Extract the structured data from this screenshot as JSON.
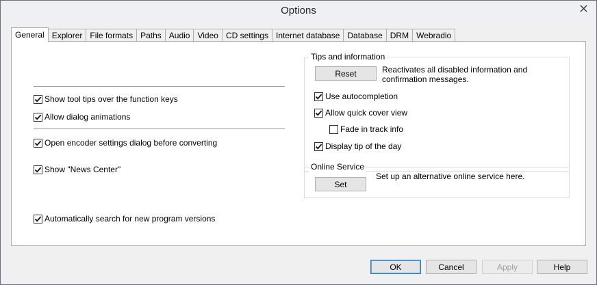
{
  "window": {
    "title": "Options",
    "close_icon": "close-icon"
  },
  "tabs": [
    {
      "label": "General",
      "active": true
    },
    {
      "label": "Explorer"
    },
    {
      "label": "File formats"
    },
    {
      "label": "Paths"
    },
    {
      "label": "Audio"
    },
    {
      "label": "Video"
    },
    {
      "label": "CD settings"
    },
    {
      "label": "Internet database"
    },
    {
      "label": "Database"
    },
    {
      "label": "DRM"
    },
    {
      "label": "Webradio"
    }
  ],
  "general": {
    "tooltips": {
      "label": "Show tool tips over the function keys",
      "checked": true
    },
    "animations": {
      "label": "Allow dialog animations",
      "checked": true
    },
    "encoder": {
      "label": "Open encoder settings dialog before converting",
      "checked": true
    },
    "news": {
      "label": "Show \"News Center\"",
      "checked": true
    },
    "updates": {
      "label": "Automatically search for new program versions",
      "checked": true
    }
  },
  "tips": {
    "title": "Tips and information",
    "reset_label": "Reset",
    "reset_desc": "Reactivates all disabled information and confirmation messages.",
    "autocomplete": {
      "label": "Use autocompletion",
      "checked": true
    },
    "quickcover": {
      "label": "Allow quick cover view",
      "checked": true
    },
    "fade": {
      "label": "Fade in track info",
      "checked": false
    },
    "tipofday": {
      "label": "Display tip of the day",
      "checked": true
    }
  },
  "online": {
    "title": "Online Service",
    "set_label": "Set",
    "set_desc": "Set up an alternative online service here."
  },
  "footer": {
    "ok": "OK",
    "cancel": "Cancel",
    "apply": "Apply",
    "help": "Help"
  }
}
